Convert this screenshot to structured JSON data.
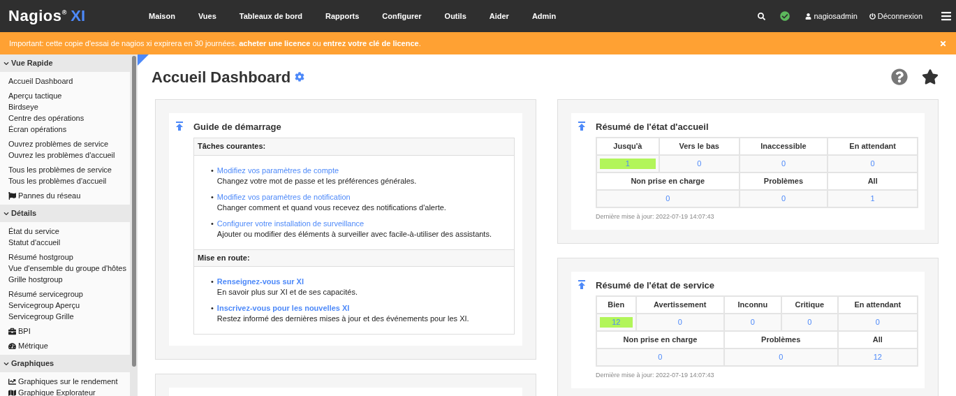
{
  "topbar": {
    "logo": {
      "name": "Nagios",
      "mark": "®",
      "product": "XI"
    },
    "nav": [
      "Maison",
      "Vues",
      "Tableaux de bord",
      "Rapports",
      "Configurer",
      "Outils",
      "Aider",
      "Admin"
    ],
    "status_ok": true,
    "user": "nagiosadmin",
    "logout": "Déconnexion"
  },
  "banner": {
    "text": "Important: cette copie d'essai de nagios xi expirera en 30 journées.",
    "link_1": "acheter une licence",
    "between": "ou",
    "link_2": "entrez votre clé de licence",
    "end": "."
  },
  "sidebar": {
    "sections": [
      {
        "title": "Vue Rapide",
        "expanded": true,
        "groups": [
          [
            {
              "label": "Accueil Dashboard"
            }
          ],
          [
            {
              "label": "Aperçu tactique"
            },
            {
              "label": "Birdseye"
            },
            {
              "label": "Centre des opérations"
            },
            {
              "label": "Écran opérations"
            }
          ],
          [
            {
              "label": "Ouvrez problèmes de service"
            },
            {
              "label": "Ouvrez les problèmes d'accueil"
            }
          ],
          [
            {
              "label": "Tous les problèmes de service"
            },
            {
              "label": "Tous les problèmes d'accueil"
            }
          ],
          [
            {
              "label": "Pannes du réseau",
              "kind": "flag"
            }
          ]
        ]
      },
      {
        "title": "Détails",
        "expanded": true,
        "groups": [
          [
            {
              "label": "État du service"
            },
            {
              "label": "Statut d'accueil"
            }
          ],
          [
            {
              "label": "Résumé hostgroup"
            },
            {
              "label": "Vue d'ensemble du groupe d'hôtes"
            },
            {
              "label": "Grille hostgroup"
            }
          ],
          [
            {
              "label": "Résumé servicegroup"
            },
            {
              "label": "Servicegroup Aperçu"
            },
            {
              "label": "Servicegroup Grille"
            }
          ],
          [
            {
              "label": "BPI",
              "kind": "briefcase"
            }
          ],
          [
            {
              "label": "Métrique",
              "kind": "gauge"
            }
          ]
        ]
      },
      {
        "title": "Graphiques",
        "expanded": true,
        "groups": [
          [
            {
              "label": "Graphiques sur le rendement",
              "kind": "chart"
            },
            {
              "label": "Graphique Explorateur",
              "kind": "map"
            }
          ]
        ]
      }
    ]
  },
  "page": {
    "title": "Accueil Dashboard"
  },
  "guide": {
    "title": "Guide de démarrage",
    "sections": [
      {
        "title": "Tâches courantes:",
        "items": [
          {
            "bullet": "•",
            "link": "Modifiez vos paramètres de compte",
            "strong": false,
            "desc": "Changez votre mot de passe et les préférences générales."
          },
          {
            "bullet": "•",
            "link": "Modifiez vos paramètres de notification",
            "strong": false,
            "desc": "Changer comment et quand vous recevez des notifications d'alerte."
          },
          {
            "bullet": "•",
            "link": "Configurer votre installation de surveillance",
            "strong": false,
            "desc": "Ajouter ou modifier des éléments à surveiller avec facile-à-utiliser des assistants."
          }
        ]
      },
      {
        "title": "Mise en route:",
        "items": [
          {
            "bullet": "•",
            "link": "Renseignez-vous sur XI",
            "strong": true,
            "desc": "En savoir plus sur XI et de ses capacités."
          },
          {
            "bullet": "•",
            "link": "Inscrivez-vous pour les nouvelles XI",
            "strong": true,
            "desc": "Restez informé des dernières mises à jour et des événements pour les XI."
          }
        ]
      }
    ]
  },
  "summaries": [
    {
      "title": "Résumé de l'état d'accueil",
      "rows": [
        {
          "kind": "header",
          "cells": [
            {
              "text": "Jusqu'à"
            },
            {
              "text": "Vers le bas"
            },
            {
              "text": "Inaccessible"
            },
            {
              "text": "En attendant"
            }
          ]
        },
        {
          "kind": "values",
          "cells": [
            {
              "text": "1",
              "ok": true
            },
            {
              "text": "0",
              "ok": false
            },
            {
              "text": "0",
              "ok": false
            },
            {
              "text": "0",
              "ok": false
            }
          ]
        },
        {
          "kind": "header",
          "cells": [
            {
              "text": "Non prise en charge",
              "colspan": 2
            },
            {
              "text": "Problèmes"
            },
            {
              "text": "All"
            }
          ]
        },
        {
          "kind": "values",
          "cells": [
            {
              "text": "0",
              "ok": false,
              "colspan": 2
            },
            {
              "text": "0",
              "ok": false
            },
            {
              "text": "1",
              "ok": false
            }
          ]
        }
      ],
      "updated": "Dernière mise à jour: 2022-07-19 14:07:43"
    },
    {
      "title": "Résumé de l'état de service",
      "rows": [
        {
          "kind": "header",
          "cells": [
            {
              "text": "Bien"
            },
            {
              "text": "Avertissement"
            },
            {
              "text": "Inconnu"
            },
            {
              "text": "Critique"
            },
            {
              "text": "En attendant"
            }
          ]
        },
        {
          "kind": "values",
          "cells": [
            {
              "text": "12",
              "ok": true
            },
            {
              "text": "0",
              "ok": false
            },
            {
              "text": "0",
              "ok": false
            },
            {
              "text": "0",
              "ok": false
            },
            {
              "text": "0",
              "ok": false
            }
          ]
        },
        {
          "kind": "header",
          "cells": [
            {
              "text": "Non prise en charge",
              "colspan": 2
            },
            {
              "text": "Problèmes",
              "colspan": 2
            },
            {
              "text": "All"
            }
          ]
        },
        {
          "kind": "values",
          "cells": [
            {
              "text": "0",
              "ok": false,
              "colspan": 2
            },
            {
              "text": "0",
              "ok": false,
              "colspan": 2
            },
            {
              "text": "12",
              "ok": false
            }
          ]
        }
      ],
      "updated": "Dernière mise à jour: 2022-07-19 14:07:43"
    }
  ]
}
